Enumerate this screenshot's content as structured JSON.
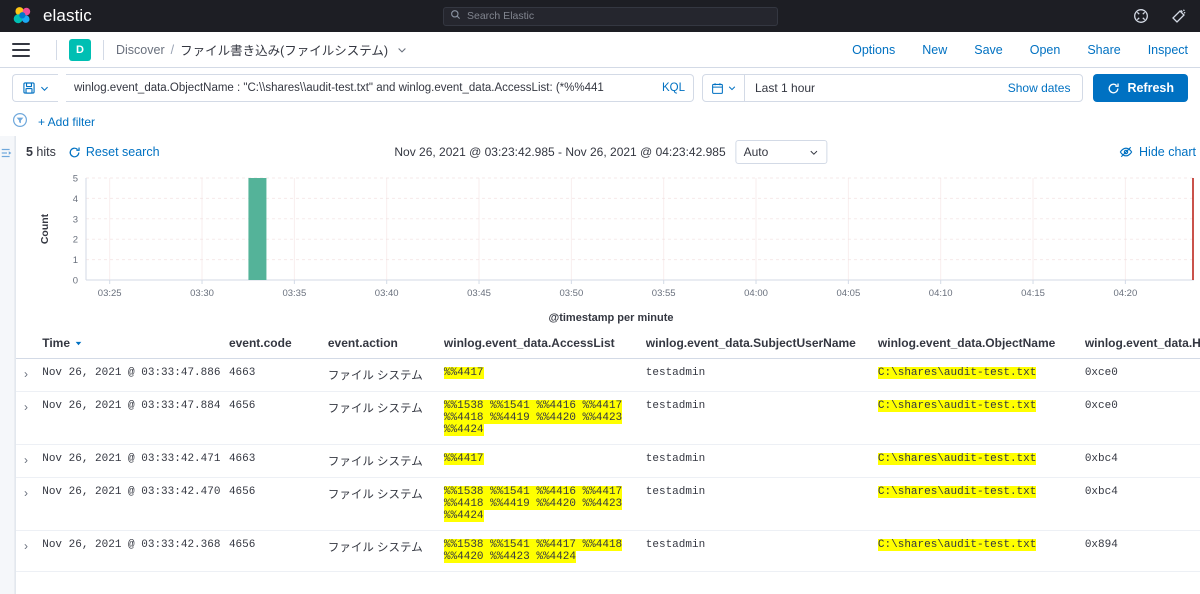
{
  "topnav": {
    "brand": "elastic",
    "search_placeholder": "Search Elastic",
    "icons": [
      {
        "name": "help-icon",
        "glyph": "?"
      },
      {
        "name": "news-feed-icon",
        "glyph": "news"
      }
    ]
  },
  "breadcrumbs": {
    "space_initial": "D",
    "app": "Discover",
    "separator": "/",
    "saved_search": "ファイル書き込み(ファイルシステム)",
    "actions": [
      "Options",
      "New",
      "Save",
      "Open",
      "Share",
      "Inspect"
    ]
  },
  "querybar": {
    "query": "winlog.event_data.ObjectName : \"C:\\\\shares\\\\audit-test.txt\"  and winlog.event_data.AccessList: (*%%441",
    "language_label": "KQL",
    "date_range": "Last 1 hour",
    "show_dates_label": "Show dates",
    "refresh_label": "Refresh"
  },
  "filterbar": {
    "add_filter_label": "+ Add filter"
  },
  "discover": {
    "hits_number": "5",
    "hits_suffix": " hits",
    "reset_search_label": "Reset search",
    "chart_range": "Nov 26, 2021 @ 03:23:42.985 - Nov 26, 2021 @ 04:23:42.985",
    "interval": "Auto",
    "hide_chart_label": "Hide chart"
  },
  "chart_data": {
    "type": "bar",
    "title": "",
    "xlabel": "@timestamp per minute",
    "ylabel": "Count",
    "categories": [
      "03:25",
      "03:30",
      "03:35",
      "03:40",
      "03:45",
      "03:50",
      "03:55",
      "04:00",
      "04:05",
      "04:10",
      "04:15",
      "04:20"
    ],
    "x_ticks": [
      "03:25",
      "03:30",
      "03:35",
      "03:40",
      "03:45",
      "03:50",
      "03:55",
      "04:00",
      "04:05",
      "04:10",
      "04:15",
      "04:20"
    ],
    "y_ticks": [
      "0",
      "1",
      "2",
      "3",
      "4",
      "5"
    ],
    "ylim": [
      0,
      5
    ],
    "bars": [
      {
        "time": "03:33",
        "value": 5
      }
    ],
    "bar_color": "#54B399",
    "current_time_marker": {
      "time": "04:23",
      "color": "#BD271E"
    },
    "grid": true,
    "legend": "none"
  },
  "table": {
    "columns": [
      "Time",
      "event.code",
      "event.action",
      "winlog.event_data.AccessList",
      "winlog.event_data.SubjectUserName",
      "winlog.event_data.ObjectName",
      "winlog.event_data.Ha"
    ],
    "sort_column": "Time",
    "rows": [
      {
        "time": "Nov 26, 2021 @ 03:33:47.886",
        "event_code": "4663",
        "event_action": "ファイル システム",
        "access_list": "%%4417",
        "subject_user_name": "testadmin",
        "object_name": "C:\\shares\\audit-test.txt",
        "handle": "0xce0"
      },
      {
        "time": "Nov 26, 2021 @ 03:33:47.884",
        "event_code": "4656",
        "event_action": "ファイル システム",
        "access_list": "%%1538 %%1541 %%4416 %%4417 %%4418 %%4419 %%4420 %%4423 %%4424",
        "subject_user_name": "testadmin",
        "object_name": "C:\\shares\\audit-test.txt",
        "handle": "0xce0"
      },
      {
        "time": "Nov 26, 2021 @ 03:33:42.471",
        "event_code": "4663",
        "event_action": "ファイル システム",
        "access_list": "%%4417",
        "subject_user_name": "testadmin",
        "object_name": "C:\\shares\\audit-test.txt",
        "handle": "0xbc4"
      },
      {
        "time": "Nov 26, 2021 @ 03:33:42.470",
        "event_code": "4656",
        "event_action": "ファイル システム",
        "access_list": "%%1538 %%1541 %%4416 %%4417 %%4418 %%4419 %%4420 %%4423 %%4424",
        "subject_user_name": "testadmin",
        "object_name": "C:\\shares\\audit-test.txt",
        "handle": "0xbc4"
      },
      {
        "time": "Nov 26, 2021 @ 03:33:42.368",
        "event_code": "4656",
        "event_action": "ファイル システム",
        "access_list": "%%1538 %%1541 %%4417 %%4418 %%4420 %%4423 %%4424",
        "subject_user_name": "testadmin",
        "object_name": "C:\\shares\\audit-test.txt",
        "handle": "0x894"
      }
    ]
  },
  "colors": {
    "accent": "#0071C2",
    "bar": "#54B399",
    "highlight": "#FFFF00",
    "space_badge": "#00BFB3",
    "topnav_bg": "#1D1E24"
  }
}
